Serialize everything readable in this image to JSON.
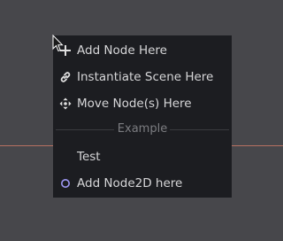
{
  "context_menu": {
    "items": [
      {
        "label": "Add Node Here",
        "icon": "plus-icon"
      },
      {
        "label": "Instantiate Scene Here",
        "icon": "link-icon"
      },
      {
        "label": "Move Node(s) Here",
        "icon": "move-arrows-icon"
      }
    ],
    "section_label": "Example",
    "section_items": [
      {
        "label": "Test"
      },
      {
        "label": "Add Node2D here",
        "icon": "node2d-circle-icon"
      }
    ]
  },
  "colors": {
    "viewport_bg": "#47474b",
    "menu_bg": "#1c1d21",
    "text": "#d6d6d8",
    "axis_line": "#b77061",
    "node2d_icon": "#9e98f4"
  }
}
